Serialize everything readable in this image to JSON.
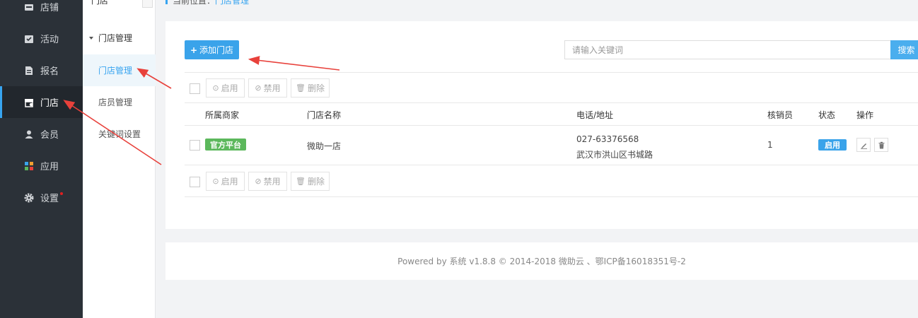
{
  "sidebar": {
    "items": [
      {
        "label": "店铺",
        "icon": "store-icon"
      },
      {
        "label": "活动",
        "icon": "activity-icon"
      },
      {
        "label": "报名",
        "icon": "signup-doc-icon"
      },
      {
        "label": "门店",
        "icon": "shop-icon",
        "active": true
      },
      {
        "label": "会员",
        "icon": "member-icon"
      },
      {
        "label": "应用",
        "icon": "apps-icon"
      },
      {
        "label": "设置",
        "icon": "gear-icon",
        "badge": "red-dot"
      }
    ]
  },
  "subnav": {
    "top_label": "门店",
    "group_label": "门店管理",
    "items": [
      {
        "label": "门店管理",
        "active": true
      },
      {
        "label": "店员管理"
      },
      {
        "label": "关键词设置"
      }
    ]
  },
  "breadcrumb": {
    "prefix": "当前位置：",
    "current": "门店管理"
  },
  "toolbar": {
    "add_label": "添加门店",
    "search_placeholder": "请输入关键词",
    "search_label": "搜索"
  },
  "bulk_actions": {
    "enable": "启用",
    "disable": "禁用",
    "delete": "删除"
  },
  "table": {
    "headers": [
      "所属商家",
      "门店名称",
      "电话/地址",
      "核销员",
      "状态",
      "操作"
    ],
    "rows": [
      {
        "merchant": "官方平台",
        "name": "微助一店",
        "phone": "027-63376568",
        "address": "武汉市洪山区书城路",
        "verifiers": "1",
        "status": "启用"
      }
    ]
  },
  "footer": {
    "text": "Powered by 系统 v1.8.8 © 2014-2018 微助云 、鄂ICP备16018351号-2"
  },
  "colors": {
    "accent": "#37a4f0",
    "sidebar_bg": "#2b3138",
    "tag_green": "#5cb85c",
    "annotation_red": "#e8413b"
  }
}
